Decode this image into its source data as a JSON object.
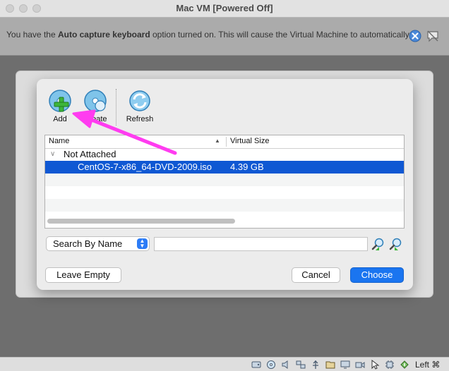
{
  "window": {
    "title": "Mac VM [Powered Off]"
  },
  "banner": {
    "text_before": "You have the ",
    "text_bold": "Auto capture keyboard",
    "text_after": " option turned on. This will cause the Virtual Machine to automatically"
  },
  "toolbar": {
    "add_label": "Add",
    "create_label": "Create",
    "refresh_label": "Refresh"
  },
  "tree": {
    "columns": {
      "name": "Name",
      "size": "Virtual Size"
    },
    "group": {
      "label": "Not Attached"
    },
    "items": [
      {
        "name": "CentOS-7-x86_64-DVD-2009.iso",
        "size": "4.39 GB"
      }
    ]
  },
  "search": {
    "mode": "Search By Name",
    "query": ""
  },
  "buttons": {
    "leave_empty": "Leave Empty",
    "cancel": "Cancel",
    "choose": "Choose"
  },
  "statusbar": {
    "host_key": "Left ⌘"
  },
  "colors": {
    "accent": "#1a75f0",
    "selection": "#0f58d3",
    "annotation": "#ff3cf0"
  }
}
